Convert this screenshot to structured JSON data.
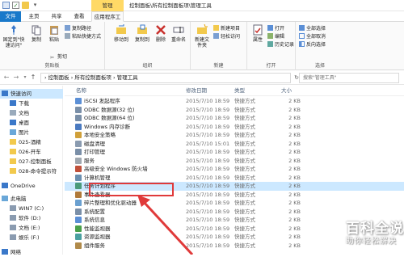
{
  "window": {
    "ctx_tab": "管理",
    "title": "控制面板\\所有控制面板项\\管理工具"
  },
  "ribbon_tabs": {
    "file": "文件",
    "home": "主页",
    "share": "共享",
    "view": "查看",
    "manage": "应用程序工具"
  },
  "ribbon": {
    "clipboard": {
      "label": "剪贴板",
      "pin": "固定到\"快速访问\"",
      "copy": "复制",
      "paste": "粘贴",
      "cut": "剪切",
      "copy_path": "复制路径",
      "paste_shortcut": "粘贴快捷方式"
    },
    "organize": {
      "label": "组织",
      "move_to": "移动到",
      "copy_to": "复制到",
      "delete": "删除",
      "rename": "重命名"
    },
    "new": {
      "label": "新建",
      "new_folder": "新建文件夹",
      "new_item": "新建项目",
      "easy_access": "轻松访问"
    },
    "open": {
      "label": "打开",
      "properties": "属性",
      "open": "打开",
      "edit": "编辑",
      "history": "历史记录"
    },
    "select": {
      "label": "选择",
      "select_all": "全部选择",
      "select_none": "全部取消",
      "invert": "反向选择"
    }
  },
  "address": {
    "path": "› 控制面板 › 所有控制面板项 › 管理工具",
    "search_placeholder": "搜索\"管理工具\""
  },
  "nav": {
    "items": [
      {
        "label": "快速访问",
        "icon": "star-icon"
      },
      {
        "label": "下载",
        "icon": "download-icon"
      },
      {
        "label": "文档",
        "icon": "document-icon"
      },
      {
        "label": "桌面",
        "icon": "desktop-icon"
      },
      {
        "label": "图片",
        "icon": "pictures-icon"
      },
      {
        "label": "025-酒精",
        "icon": "folder-icon"
      },
      {
        "label": "026-开车",
        "icon": "folder-icon"
      },
      {
        "label": "027-控制面板",
        "icon": "folder-icon"
      },
      {
        "label": "028-命令提示符",
        "icon": "folder-icon"
      },
      {
        "label": "OneDrive",
        "icon": "cloud-icon"
      },
      {
        "label": "此电脑",
        "icon": "computer-icon"
      },
      {
        "label": "WIN7 (C:)",
        "icon": "drive-icon"
      },
      {
        "label": "软件 (D:)",
        "icon": "drive-icon"
      },
      {
        "label": "文档 (E:)",
        "icon": "drive-icon"
      },
      {
        "label": "娱乐 (F:)",
        "icon": "drive-icon"
      },
      {
        "label": "网络",
        "icon": "network-icon"
      }
    ]
  },
  "columns": {
    "name": "名称",
    "date": "修改日期",
    "type": "类型",
    "size": "大小"
  },
  "files": [
    {
      "name": "iSCSI 发起程序",
      "date": "2015/7/10 18:59",
      "type": "快捷方式",
      "size": "2 KB"
    },
    {
      "name": "ODBC 数据源(32 位)",
      "date": "2015/7/10 18:59",
      "type": "快捷方式",
      "size": "2 KB"
    },
    {
      "name": "ODBC 数据源(64 位)",
      "date": "2015/7/10 18:59",
      "type": "快捷方式",
      "size": "2 KB"
    },
    {
      "name": "Windows 内存诊断",
      "date": "2015/7/10 18:59",
      "type": "快捷方式",
      "size": "2 KB"
    },
    {
      "name": "本地安全策略",
      "date": "2015/7/10 18:59",
      "type": "快捷方式",
      "size": "2 KB"
    },
    {
      "name": "磁盘清理",
      "date": "2015/7/10 15:01",
      "type": "快捷方式",
      "size": "2 KB"
    },
    {
      "name": "打印管理",
      "date": "2015/7/10 18:59",
      "type": "快捷方式",
      "size": "2 KB"
    },
    {
      "name": "服务",
      "date": "2015/7/10 18:59",
      "type": "快捷方式",
      "size": "2 KB"
    },
    {
      "name": "高级安全 Windows 防火墙",
      "date": "2015/7/10 18:59",
      "type": "快捷方式",
      "size": "2 KB"
    },
    {
      "name": "计算机管理",
      "date": "2015/7/10 18:59",
      "type": "快捷方式",
      "size": "2 KB"
    },
    {
      "name": "任务计划程序",
      "date": "2015/7/10 18:59",
      "type": "快捷方式",
      "size": "2 KB"
    },
    {
      "name": "事件查看器",
      "date": "2015/7/10 18:59",
      "type": "快捷方式",
      "size": "2 KB"
    },
    {
      "name": "碎片整理和优化驱动器",
      "date": "2015/7/10 18:59",
      "type": "快捷方式",
      "size": "2 KB"
    },
    {
      "name": "系统配置",
      "date": "2015/7/10 18:59",
      "type": "快捷方式",
      "size": "2 KB"
    },
    {
      "name": "系统信息",
      "date": "2015/7/10 18:59",
      "type": "快捷方式",
      "size": "2 KB"
    },
    {
      "name": "性能监视器",
      "date": "2015/7/10 18:59",
      "type": "快捷方式",
      "size": "2 KB"
    },
    {
      "name": "资源监视器",
      "date": "2015/7/10 18:59",
      "type": "快捷方式",
      "size": "2 KB"
    },
    {
      "name": "组件服务",
      "date": "2015/7/10 18:59",
      "type": "快捷方式",
      "size": "2 KB"
    }
  ],
  "watermark": {
    "title": "百科全说",
    "subtitle": "助你轻松解决"
  },
  "colors": {
    "accent": "#1979ca",
    "selection": "#cce8ff",
    "annotation": "#e03a3a",
    "ctx_tab": "#ffd966"
  }
}
